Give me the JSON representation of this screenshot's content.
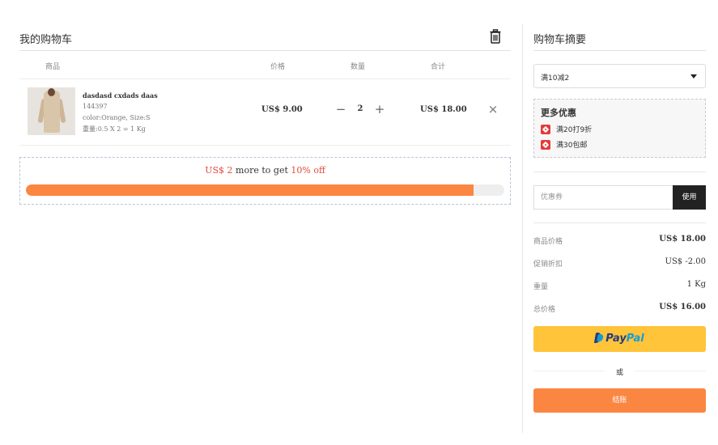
{
  "cart": {
    "title": "我的购物车",
    "columns": {
      "product": "商品",
      "price": "价格",
      "quantity": "数量",
      "total": "合计"
    },
    "items": [
      {
        "name": "dasdasd cxdads daas",
        "sku": "144397",
        "attrs": "color:Orange, Size:S",
        "weight": "重量:0.5 X 2 = 1 Kg",
        "price": "US$ 9.00",
        "qty": "2",
        "total": "US$ 18.00"
      }
    ],
    "promo": {
      "amount": "US$ 2",
      "middle": " more to get ",
      "discount": "10% off",
      "progress": 0.936
    }
  },
  "summary": {
    "title": "购物车摘要",
    "select_value": "满10减2",
    "more_title": "更多优惠",
    "offers": [
      "满20打9折",
      "满30包邮"
    ],
    "coupon_placeholder": "优惠券",
    "use_label": "使用",
    "lines": [
      {
        "label": "商品价格",
        "value": "US$ 18.00",
        "bold": true
      },
      {
        "label": "促销折扣",
        "value": "US$ -2.00",
        "bold": false
      },
      {
        "label": "重量",
        "value": "1 Kg",
        "bold": false
      },
      {
        "label": "总价格",
        "value": "US$ 16.00",
        "bold": true
      }
    ],
    "paypal_a": "Pay",
    "paypal_b": "Pal",
    "or_label": "或",
    "checkout_label": "结账"
  },
  "colors": {
    "accent": "#fb8642",
    "promo_red": "#e04a3c",
    "paypal": "#ffc439"
  }
}
